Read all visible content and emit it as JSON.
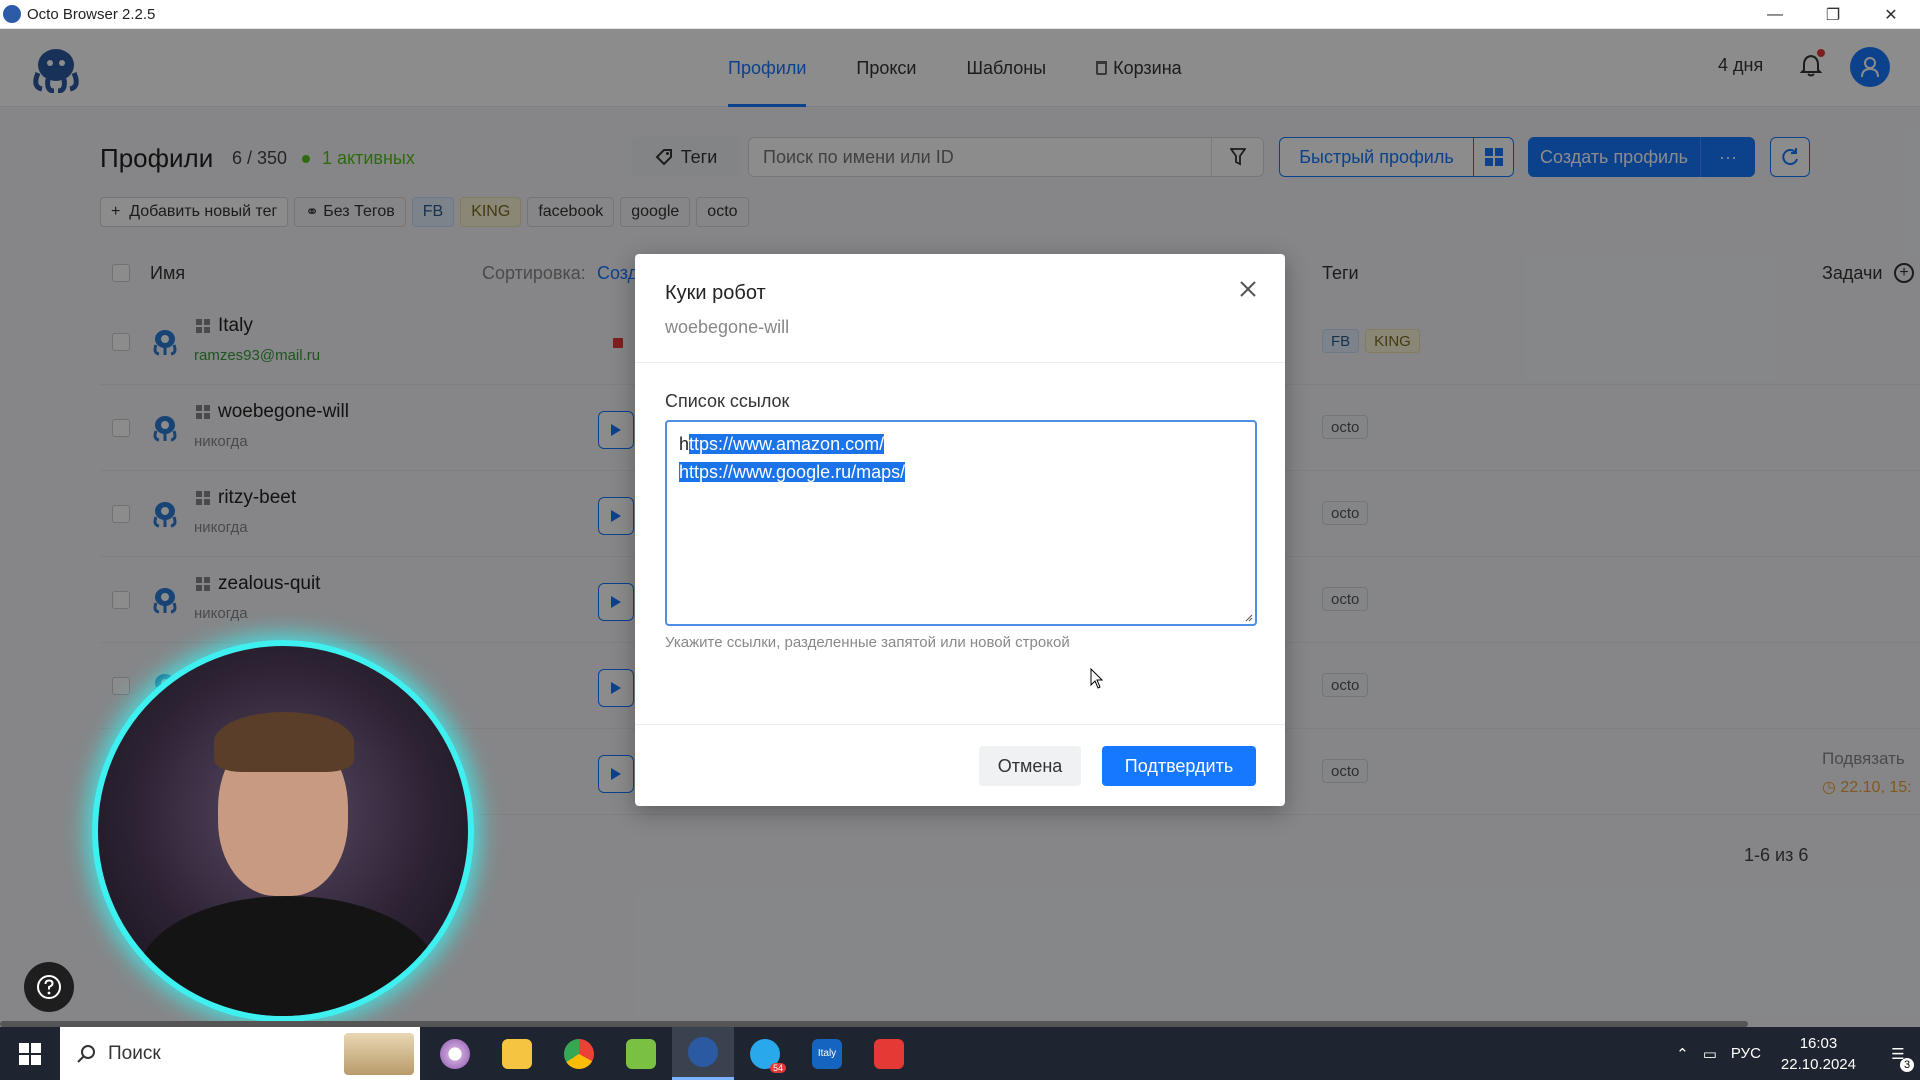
{
  "window": {
    "title": "Octo Browser 2.2.5"
  },
  "nav": {
    "tabs": [
      {
        "label": "Профили",
        "active": true
      },
      {
        "label": "Прокси",
        "active": false
      },
      {
        "label": "Шаблоны",
        "active": false
      },
      {
        "label": "Корзина",
        "active": false
      }
    ],
    "days_left": "4 дня"
  },
  "toolbar": {
    "title": "Профили",
    "count": "6 / 350",
    "active": "1 активных",
    "tags_label": "Теги",
    "search_placeholder": "Поиск по имени или ID",
    "quick_profile": "Быстрый профиль",
    "create_profile": "Создать профиль",
    "more": "···"
  },
  "tag_filters": {
    "add": "Добавить новый тег",
    "no_tags": "Без Тегов",
    "items": [
      "FB",
      "KING",
      "facebook",
      "google",
      "octo"
    ]
  },
  "table": {
    "col_name": "Имя",
    "sort_label": "Сортировка:",
    "sort_value": "Созд",
    "col_tags": "Теги",
    "col_tasks": "Задачи",
    "rows": [
      {
        "name": "Italy",
        "sub": "ramzes93@mail.ru",
        "tags": [
          "FB",
          "KING"
        ]
      },
      {
        "name": "woebegone-will",
        "sub": "никогда",
        "tags": [
          "octo"
        ]
      },
      {
        "name": "ritzy-beet",
        "sub": "никогда",
        "tags": [
          "octo"
        ]
      },
      {
        "name": "zealous-quit",
        "sub": "никогда",
        "tags": [
          "octo"
        ]
      },
      {
        "name": "",
        "sub": "",
        "tags": [
          "octo"
        ]
      },
      {
        "name": "",
        "sub": "",
        "tags": [
          "octo"
        ]
      }
    ],
    "task_text": "Подвязать",
    "task_time": "22.10, 15:",
    "pagination": "1-6 из 6"
  },
  "modal": {
    "title": "Куки робот",
    "subtitle": "woebegone-will",
    "field_label": "Список ссылок",
    "links": [
      "https://www.amazon.com/",
      "https://www.google.ru/maps/"
    ],
    "hint": "Укажите ссылки, разделенные запятой или новой строкой",
    "cancel": "Отмена",
    "confirm": "Подтвердить"
  },
  "taskbar": {
    "search_label": "Поиск",
    "lang": "РУС",
    "time": "16:03",
    "date": "22.10.2024",
    "notif_count": "3",
    "telegram_badge": "54",
    "italy_app_label": "Italy"
  },
  "colors": {
    "accent": "#1677ff",
    "active_green": "#52c41a",
    "webcam_ring": "#3ff0f0"
  }
}
